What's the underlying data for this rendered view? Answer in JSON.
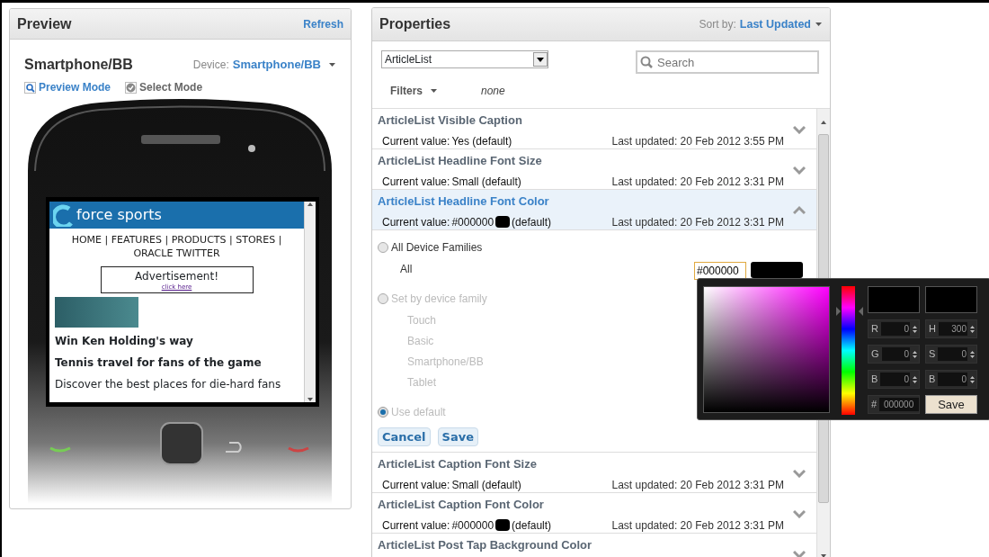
{
  "preview": {
    "title": "Preview",
    "refresh": "Refresh",
    "device_name": "Smartphone/BB",
    "device_label": "Device:",
    "device_value": "Smartphone/BB",
    "modes": [
      {
        "label": "Preview Mode",
        "selected": true
      },
      {
        "label": "Select Mode",
        "selected": false
      }
    ],
    "phone_screen": {
      "brand": "force sports",
      "nav": "HOME | FEATURES | PRODUCTS | STORES | ORACLE TWITTER",
      "ad_title": "Advertisement!",
      "ad_link": "click here",
      "headline": "Win Ken Holding's way",
      "subhead": "Tennis travel for fans of the game",
      "body": "Discover the best places for die-hard fans"
    }
  },
  "properties": {
    "title": "Properties",
    "sort_label": "Sort by:",
    "sort_value": "Last Updated",
    "component": "ArticleList",
    "search": {
      "placeholder": "Search"
    },
    "filters_label": "Filters",
    "filters_value": "none",
    "items": [
      {
        "name": "ArticleList Visible Caption",
        "value_label": "Current value:",
        "value": "Yes (default)",
        "updated": "Last updated: 20 Feb 2012 3:55 PM",
        "expanded": false
      },
      {
        "name": "ArticleList Headline Font Size",
        "value_label": "Current value:",
        "value": "Small (default)",
        "updated": "Last updated: 20 Feb 2012 3:31 PM",
        "expanded": false
      },
      {
        "name": "ArticleList Headline Font Color",
        "value_label": "Current value:",
        "value": "#000000",
        "color": "#000000",
        "suffix": "(default)",
        "updated": "Last updated: 20 Feb 2012 3:31 PM",
        "expanded": true,
        "editor": {
          "options": [
            {
              "label": "All Device Families",
              "selected": false,
              "disabled": false,
              "families": [
                "All"
              ]
            },
            {
              "label": "Set by device family",
              "selected": false,
              "disabled": true,
              "families": [
                "Touch",
                "Basic",
                "Smartphone/BB",
                "Tablet"
              ]
            },
            {
              "label": "Use default",
              "selected": true,
              "disabled": true
            }
          ],
          "color_input": "#000000",
          "color_swatch": {
            "color": "#000000"
          },
          "buttons": [
            "Cancel",
            "Save"
          ]
        }
      },
      {
        "name": "ArticleList Caption Font Size",
        "value_label": "Current value:",
        "value": "Small (default)",
        "updated": "Last updated: 20 Feb 2012 3:31 PM",
        "expanded": false
      },
      {
        "name": "ArticleList Caption Font Color",
        "value_label": "Current value:",
        "value": "#000000",
        "color": "#000000",
        "suffix": "(default)",
        "updated": "Last updated: 20 Feb 2012 3:31 PM",
        "expanded": false
      },
      {
        "name": "ArticleList Post Tap Background Color",
        "expanded": false
      }
    ]
  },
  "color_picker": {
    "current_swatch": {
      "color": "#000000"
    },
    "new_swatch": {
      "color": "#000000"
    },
    "hue": {
      "level": 0.83
    },
    "fields": [
      {
        "label": "R",
        "value": "0"
      },
      {
        "label": "H",
        "value": "300"
      },
      {
        "label": "G",
        "value": "0"
      },
      {
        "label": "S",
        "value": "0"
      },
      {
        "label": "B",
        "value": "0"
      },
      {
        "label": "B",
        "value": "0"
      }
    ],
    "hex_label": "#",
    "hex": "000000",
    "save": "Save"
  }
}
